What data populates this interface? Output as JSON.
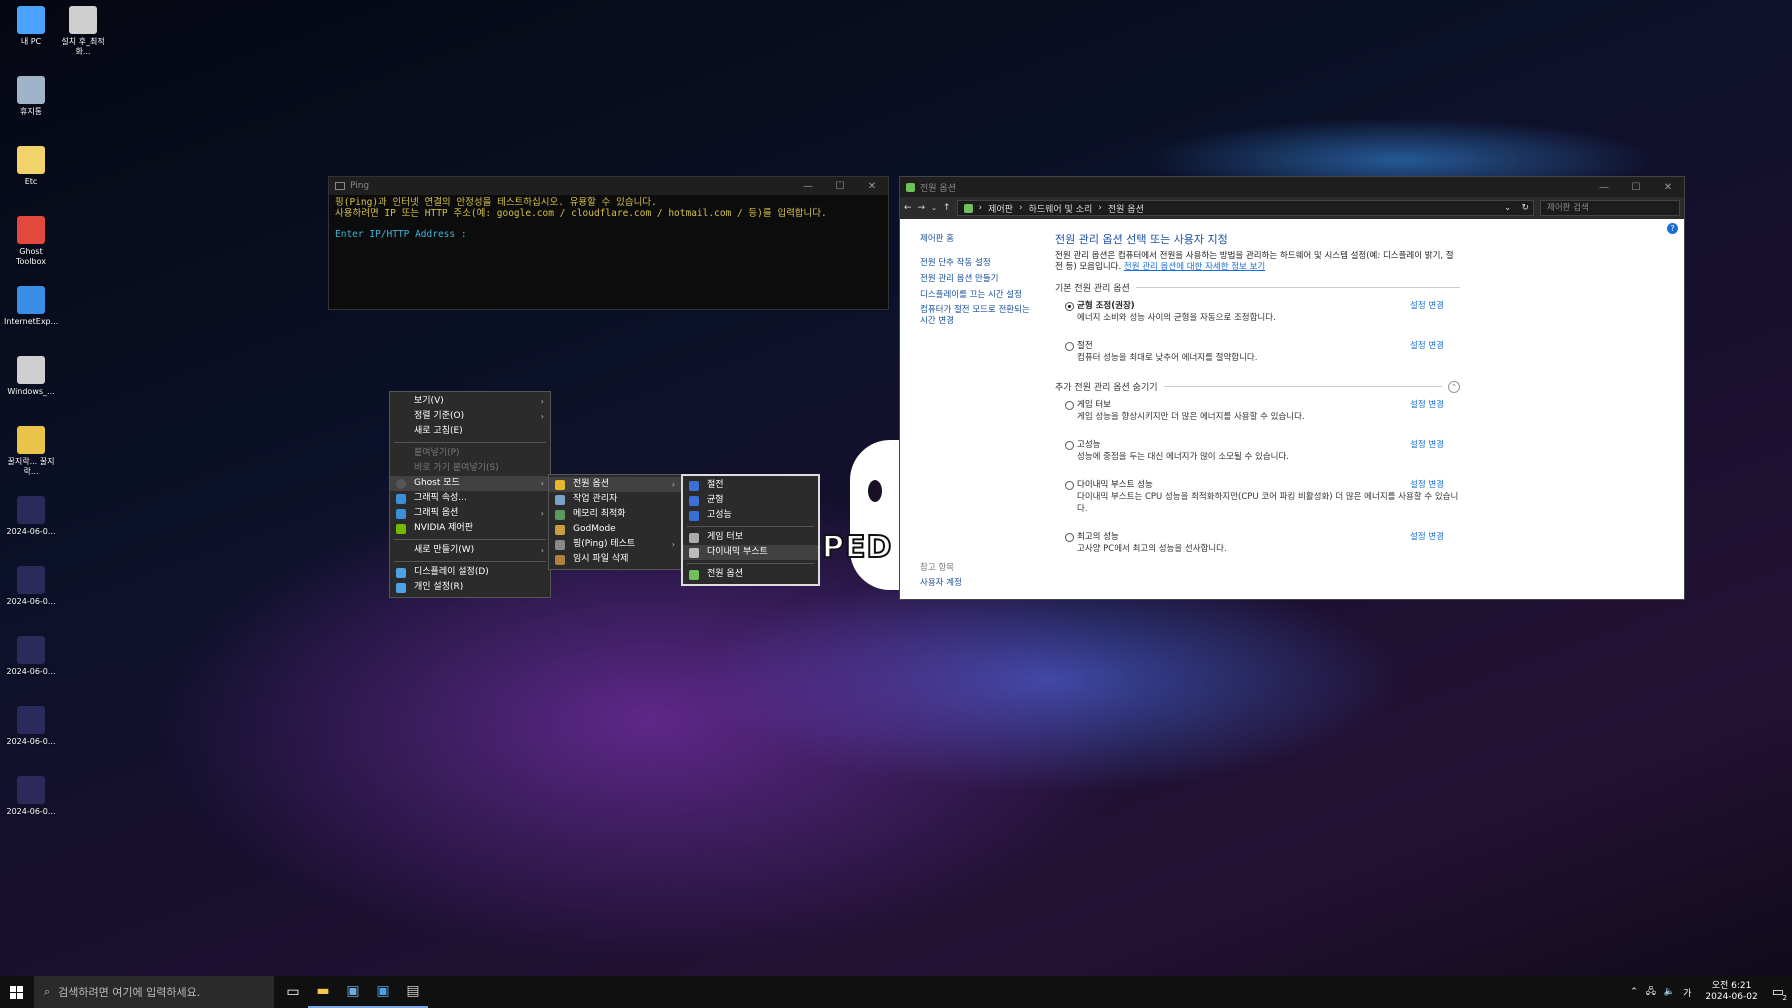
{
  "desktop": {
    "icons": [
      {
        "label": "내 PC",
        "icon": "computer-icon",
        "color": "#4aa3ff"
      },
      {
        "label": "설치 후_최적화...",
        "icon": "gear-shortcut-icon",
        "color": "#cfcfcf"
      },
      {
        "label": "휴지통",
        "icon": "recycle-bin-icon",
        "color": "#9fb4c8"
      },
      {
        "label": "Etc",
        "icon": "folder-icon",
        "color": "#f2d36b"
      },
      {
        "label": "Ghost Toolbox",
        "icon": "ghost-toolbox-icon",
        "color": "#e2483b"
      },
      {
        "label": "InternetExp...",
        "icon": "internet-explorer-icon",
        "color": "#3a8ee6"
      },
      {
        "label": "Windows_...",
        "icon": "gear-shortcut-icon",
        "color": "#cfcfcf"
      },
      {
        "label": "꿀지락... 꿀지락...",
        "icon": "ie-shortcut-icon",
        "color": "#e8c44a"
      },
      {
        "label": "2024-06-0...",
        "icon": "screenshot-icon",
        "color": "#2c2a5a"
      },
      {
        "label": "2024-06-0...",
        "icon": "screenshot-icon",
        "color": "#2c2a5a"
      },
      {
        "label": "2024-06-0...",
        "icon": "screenshot-icon",
        "color": "#2c2a5a"
      },
      {
        "label": "2024-06-0...",
        "icon": "screenshot-icon",
        "color": "#2c2a5a"
      },
      {
        "label": "2024-06-0...",
        "icon": "screenshot-icon",
        "color": "#2c2a5a"
      }
    ]
  },
  "ping": {
    "title": "Ping",
    "line1": "핑(Ping)과 인터넷 연결의 안정성을 테스트하십시오. 유용할 수 있습니다.",
    "line2": "사용하려면 IP 또는 HTTP 주소(예: google.com / cloudflare.com / hotmail.com / 등)를 입력합니다.",
    "prompt": "Enter IP/HTTP Address :"
  },
  "power": {
    "title": "전원 옵션",
    "breadcrumb": [
      "제어판",
      "하드웨어 및 소리",
      "전원 옵션"
    ],
    "search_placeholder": "제어판 검색",
    "sidebar": {
      "home": "제어판 홈",
      "links": [
        "전원 단추 작동 설정",
        "전원 관리 옵션 만들기",
        "디스플레이를 끄는 시간 설정",
        "컴퓨터가 절전 모드로 전환되는 시간 변경"
      ],
      "see_also": "참고 항목",
      "user_accounts": "사용자 계정"
    },
    "heading": "전원 관리 옵션 선택 또는 사용자 지정",
    "intro": "전원 관리 옵션은 컴퓨터에서 전원을 사용하는 방법을 관리하는 하드웨어 및 시스템 설정(예: 디스플레이 밝기, 절전 등) 모음입니다.",
    "intro_link": "전원 관리 옵션에 대한 자세한 정보 보기",
    "basic_section": "기본 전원 관리 옵션",
    "extra_section": "추가 전원 관리 옵션 숨기기",
    "change_label": "설정 변경",
    "basic_plans": [
      {
        "name": "균형 조정(권장)",
        "desc": "에너지 소비와 성능 사이의 균형을 자동으로 조정합니다.",
        "selected": true
      },
      {
        "name": "절전",
        "desc": "컴퓨터 성능을 최대로 낮추어 에너지를 절약합니다.",
        "selected": false
      }
    ],
    "extra_plans": [
      {
        "name": "게임 터보",
        "desc": "게임 성능을 향상시키지만 더 많은 에너지를 사용할 수 있습니다."
      },
      {
        "name": "고성능",
        "desc": "성능에 중점을 두는 대신 에너지가 많이 소모될 수 있습니다."
      },
      {
        "name": "다이내믹 부스트 성능",
        "desc": "다이내믹 부스트는 CPU 성능을 최적화하지만(CPU 코어 파킹 비활성화) 더 많은 에너지를 사용할 수 있습니다."
      },
      {
        "name": "최고의 성능",
        "desc": "고사양 PC에서 최고의 성능을 선사합니다."
      }
    ]
  },
  "menu1": {
    "items": [
      "보기(V)",
      "정렬 기준(O)",
      "새로 고침(E)",
      "붙여넣기(P)",
      "바로 가기 붙여넣기(S)",
      "Ghost 모드",
      "그래픽 속성...",
      "그래픽 옵션",
      "NVIDIA 제어판",
      "새로 만들기(W)",
      "디스플레이 설정(D)",
      "개인 설정(R)"
    ]
  },
  "menu2": {
    "items": [
      "전원 옵션",
      "작업 관리자",
      "메모리 최적화",
      "GodMode",
      "핑(Ping) 테스트",
      "임시 파일 삭제"
    ]
  },
  "menu3": {
    "items": [
      "절전",
      "균형",
      "고성능",
      "게임 터보",
      "다이내믹 부스트",
      "전원 옵션"
    ]
  },
  "taskbar": {
    "search_placeholder": "검색하려면 여기에 입력하세요.",
    "ime": "가",
    "time": "오전 6:21",
    "date": "2024-06-02",
    "notif_count": "2"
  },
  "watermark": "PED"
}
